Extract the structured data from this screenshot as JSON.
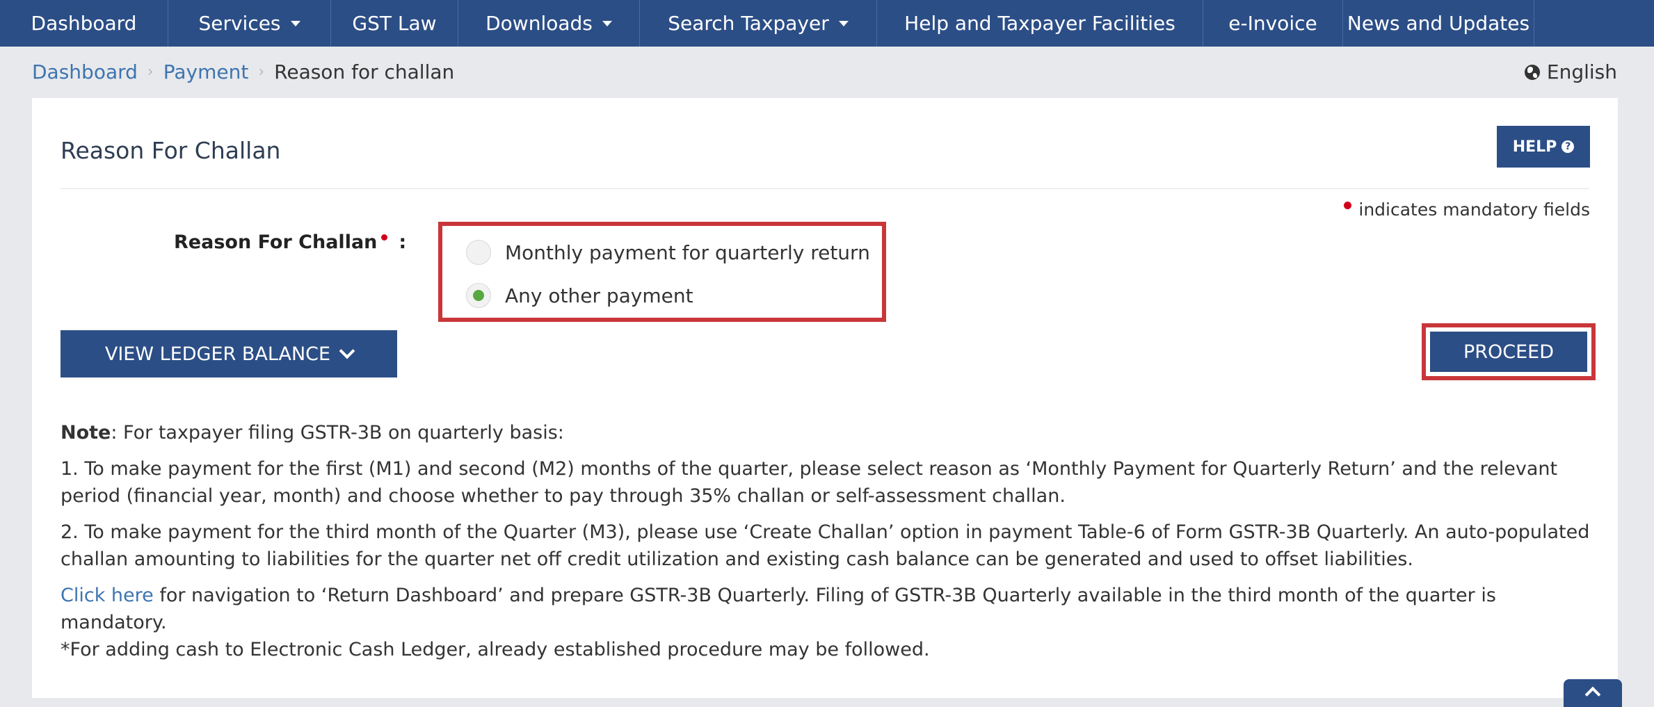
{
  "nav": [
    {
      "label": "Dashboard",
      "dropdown": false
    },
    {
      "label": "Services",
      "dropdown": true
    },
    {
      "label": "GST Law",
      "dropdown": false
    },
    {
      "label": "Downloads",
      "dropdown": true
    },
    {
      "label": "Search Taxpayer",
      "dropdown": true
    },
    {
      "label": "Help and Taxpayer Facilities",
      "dropdown": false
    },
    {
      "label": "e-Invoice",
      "dropdown": false
    },
    {
      "label": "News and Updates",
      "dropdown": false
    }
  ],
  "breadcrumb": {
    "items": [
      "Dashboard",
      "Payment"
    ],
    "current": "Reason for challan"
  },
  "language": "English",
  "page": {
    "title": "Reason For Challan",
    "help_label": "HELP",
    "mandatory_note": "indicates mandatory fields"
  },
  "form": {
    "label": "Reason For Challan",
    "colon": ":",
    "options": [
      {
        "label": "Monthly payment for quarterly return",
        "selected": false
      },
      {
        "label": "Any other payment",
        "selected": true
      }
    ]
  },
  "buttons": {
    "view_ledger": "VIEW LEDGER BALANCE",
    "proceed": "PROCEED"
  },
  "notes": {
    "label": "Note",
    "intro": ": For taxpayer filing GSTR-3B on quarterly basis:",
    "point1": "1. To make payment for the first (M1) and second (M2) months of the quarter, please select reason as ‘Monthly Payment for Quarterly Return’ and the relevant period (financial year, month) and choose whether to pay through 35% challan or self-assessment challan.",
    "point2": "2. To make payment for the third month of the Quarter (M3), please use ‘Create Challan’ option in payment Table-6 of Form GSTR-3B Quarterly. An auto-populated challan amounting to liabilities for the quarter net off credit utilization and existing cash balance can be generated and used to offset liabilities.",
    "click_here": "Click here",
    "click_text": " for navigation to ‘Return Dashboard’ and prepare GSTR-3B Quarterly. Filing of GSTR-3B Quarterly available in the third month of the quarter is mandatory.",
    "footnote": "*For adding cash to Electronic Cash Ledger, already established procedure may be followed."
  },
  "colors": {
    "nav_bg": "#2c4e86",
    "highlight": "#c9363a",
    "radio_selected": "#58a841",
    "link": "#3d74b0",
    "mandatory": "#d0021b"
  }
}
